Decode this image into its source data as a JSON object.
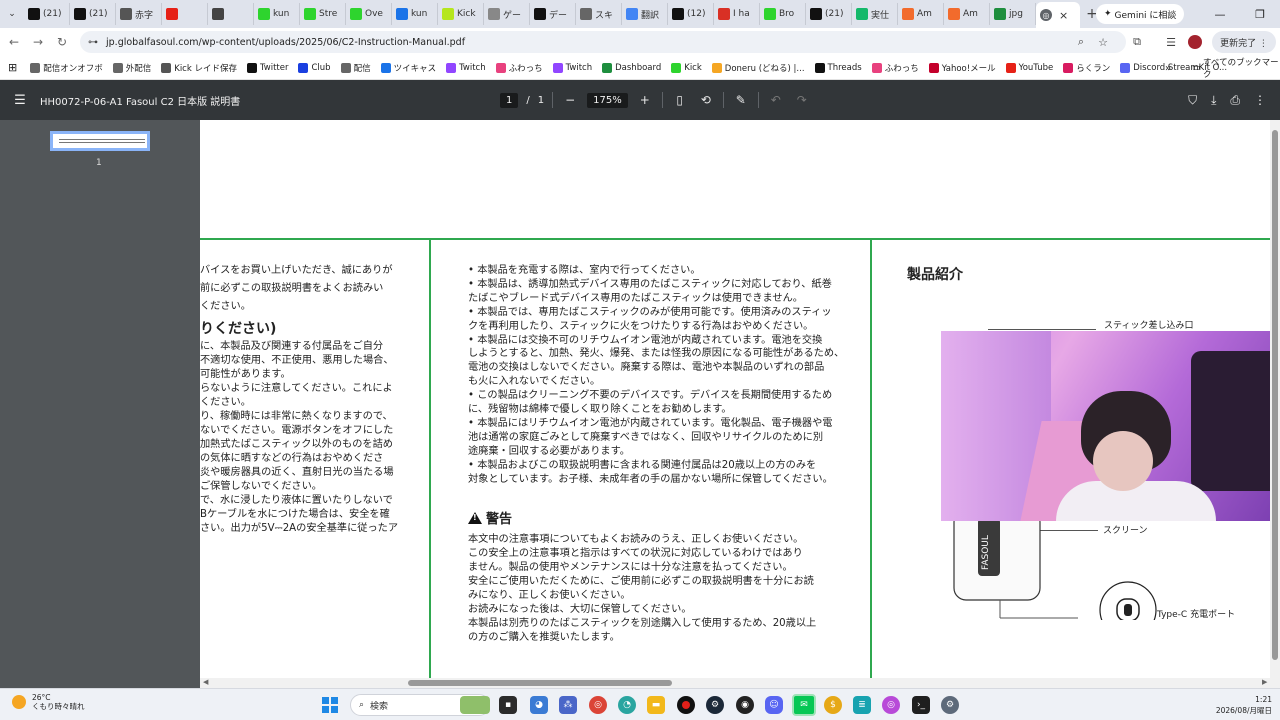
{
  "tabstrip": {
    "tabs": [
      {
        "label": "(21)",
        "icon": "x-logo",
        "color": "#111111"
      },
      {
        "label": "(21)",
        "icon": "x-logo",
        "color": "#111111"
      },
      {
        "label": "赤字",
        "icon": "doc-icon",
        "color": "#555555"
      },
      {
        "label": "",
        "icon": "youtube-icon",
        "color": "#e62117"
      },
      {
        "label": "",
        "icon": "audio-icon",
        "color": "#444444"
      },
      {
        "label": "kun",
        "icon": "kick-logo",
        "color": "#2ed42e"
      },
      {
        "label": "Stre",
        "icon": "kick-logo",
        "color": "#2ed42e"
      },
      {
        "label": "Ove",
        "icon": "kick-logo",
        "color": "#2ed42e"
      },
      {
        "label": "kun",
        "icon": "refresh-icon",
        "color": "#1a73e8"
      },
      {
        "label": "Kick",
        "icon": "kick-logo",
        "color": "#b5e61d"
      },
      {
        "label": "ゲー",
        "icon": "spinner-icon",
        "color": "#888888"
      },
      {
        "label": "デー",
        "icon": "openai-logo",
        "color": "#111111"
      },
      {
        "label": "スキ",
        "icon": "grid-icon",
        "color": "#666666"
      },
      {
        "label": "翻訳",
        "icon": "google-logo",
        "color": "#4285f4"
      },
      {
        "label": "(12)",
        "icon": "x-logo",
        "color": "#111111"
      },
      {
        "label": "I ha",
        "icon": "gmail-logo",
        "color": "#d93025"
      },
      {
        "label": "Bro",
        "icon": "kick-logo",
        "color": "#2ed42e"
      },
      {
        "label": "(21)",
        "icon": "x-logo",
        "color": "#111111"
      },
      {
        "label": "実仕",
        "icon": "v-logo",
        "color": "#14b86a"
      },
      {
        "label": "Am",
        "icon": "amazon-icon",
        "color": "#f26b2c"
      },
      {
        "label": "Am",
        "icon": "amazon-icon",
        "color": "#f26b2c"
      },
      {
        "label": "jpg",
        "icon": "image-icon",
        "color": "#1e8e3e"
      }
    ],
    "active_tab": {
      "icon": "chrome-icon",
      "close": "×"
    },
    "new_tab": "+",
    "gemini_label": "Gemini に相談",
    "window_controls": [
      "—",
      "❐",
      "✕"
    ]
  },
  "addressbar": {
    "url": "jp.globalfasoul.com/wp-content/uploads/2025/06/C2-Instruction-Manual.pdf",
    "profile_label": "更新完了 ⋮"
  },
  "bookmarks": [
    {
      "label": "配信オンオフボ",
      "icon": "chrome-icon",
      "color": "#666666"
    },
    {
      "label": "外配信",
      "icon": "chrome-icon",
      "color": "#666666"
    },
    {
      "label": "Kick レイド保存",
      "icon": "globe-icon",
      "color": "#555555"
    },
    {
      "label": "Twitter",
      "icon": "x-logo",
      "color": "#111111"
    },
    {
      "label": "Club",
      "icon": "club-icon",
      "color": "#1a3fe0"
    },
    {
      "label": "配信",
      "icon": "chrome-icon",
      "color": "#666666"
    },
    {
      "label": "ツイキャス",
      "icon": "twitcasting-icon",
      "color": "#1a73e8"
    },
    {
      "label": "Twitch",
      "icon": "twitch-icon",
      "color": "#9146ff"
    },
    {
      "label": "ふわっち",
      "icon": "whowatch-icon",
      "color": "#e8417e"
    },
    {
      "label": "Twitch",
      "icon": "twitch-icon",
      "color": "#9146ff"
    },
    {
      "label": "Dashboard",
      "icon": "dashboard-icon",
      "color": "#1e8e3e"
    },
    {
      "label": "Kick",
      "icon": "kick-logo",
      "color": "#2ed42e"
    },
    {
      "label": "Doneru (どねる) |...",
      "icon": "doneru-icon",
      "color": "#f5a623"
    },
    {
      "label": "Threads",
      "icon": "threads-icon",
      "color": "#111111"
    },
    {
      "label": "ふわっち",
      "icon": "whowatch-icon",
      "color": "#e8417e"
    },
    {
      "label": "Yahoo!メール",
      "icon": "yahoo-icon",
      "color": "#c4002b"
    },
    {
      "label": "YouTube",
      "icon": "youtube-icon",
      "color": "#e62117"
    },
    {
      "label": "らくラン",
      "icon": "rakuran-icon",
      "color": "#d81b60"
    },
    {
      "label": "Discord StreamKit O...",
      "icon": "discord-icon",
      "color": "#5865f2"
    }
  ],
  "bookmarks_more": "»",
  "bookmarks_folder": "すべてのブックマーク",
  "pdf": {
    "title": "HH0072-P-06-A1 Fasoul C2 日本版 説明書",
    "page_current": "1",
    "page_sep": "/",
    "page_total": "1",
    "zoom": "175%"
  },
  "sidebar": {
    "thumb_page": "1"
  },
  "doc": {
    "col1": [
      "バイスをお買い上げいただき、誠にありが",
      "前に必ずこの取扱説明書をよくお読みい",
      "ください。",
      "りください)",
      "に、本製品及び関連する付属品をご自分",
      "不適切な使用、不正使用、悪用した場合、",
      "可能性があります。",
      "らないように注意してください。これによ",
      "ください。",
      "り、稼働時には非常に熱くなりますので、",
      "ないでください。電源ボタンをオフにした",
      "加熱式たばこスティック以外のものを詰め",
      "の気体に晒すなどの行為はおやめくださ",
      "炎や暖房器具の近く、直射日光の当たる場",
      "ご保管しないでください。",
      "で、水に浸したり液体に置いたりしないで",
      "Bケーブルを水につけた場合は、安全を確",
      "さい。出力が5V⎓2Aの安全基準に従ったア"
    ],
    "col2": [
      "• 本製品を充電する際は、室内で行ってください。",
      "• 本製品は、誘導加熱式デバイス専用のたばこスティックに対応しており、紙巻",
      "たばこやブレード式デバイス専用のたばこスティックは使用できません。",
      "• 本製品では、専用たばこスティックのみが使用可能です。使用済みのスティッ",
      "クを再利用したり、スティックに火をつけたりする行為はおやめください。",
      "• 本製品には交換不可のリチウムイオン電池が内蔵されています。電池を交換",
      "しようとすると、加熱、発火、爆発、または怪我の原因になる可能性があるため、",
      "電池の交換はしないでください。廃棄する際は、電池や本製品のいずれの部品",
      "も火に入れないでください。",
      "• この製品はクリーニング不要のデバイスです。デバイスを長期間使用するため",
      "に、残留物は綿棒で優しく取り除くことをお勧めします。",
      "• 本製品にはリチウムイオン電池が内蔵されています。電化製品、電子機器や電",
      "池は通常の家庭ごみとして廃棄すべきではなく、回収やリサイクルのために別",
      "途廃棄・回収する必要があります。",
      "• 本製品およびこの取扱説明書に含まれる関連付属品は20歳以上の方のみを",
      "対象としています。お子様、未成年者の手の届かない場所に保管してください。"
    ],
    "warning_title": "警告",
    "warning_body": [
      "本文中の注意事項についてもよくお読みのうえ、正しくお使いください。",
      "この安全上の注意事項と指示はすべての状況に対応しているわけではあり",
      "ません。製品の使用やメンテナンスには十分な注意を払ってください。",
      "安全にご使用いただくために、ご使用前に必ずこの取扱説明書を十分にお読",
      "みになり、正しくお使いください。",
      "お読みになった後は、大切に保管してください。",
      "本製品は別売りのたばこスティックを別途購入して使用するため、20歳以上",
      "の方のご購入を推奨いたします。"
    ],
    "product_title": "製品紹介",
    "callouts": {
      "stick_slot": "スティック差し込み口",
      "screen": "スクリーン",
      "typec": "Type-C 充電ポート"
    },
    "device_brand": "FASOUL"
  },
  "taskbar": {
    "weather_temp": "26°C",
    "weather_desc": "くもり時々晴れ",
    "search_placeholder": "検索",
    "clock_time": "1:21",
    "clock_date": "2026/08/月曜日"
  },
  "colors": {
    "accent_green": "#2fa84f",
    "pdf_toolbar": "#323639",
    "sidebar": "#525659"
  }
}
